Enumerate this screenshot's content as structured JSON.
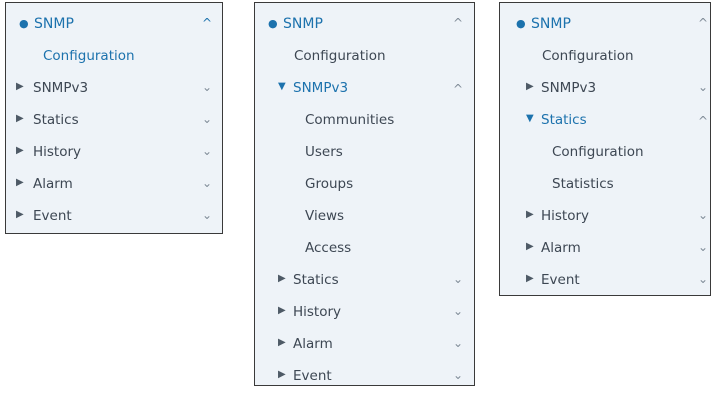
{
  "icons": {
    "bullet": "●",
    "collapsed": "▶",
    "expanded": "▼",
    "chevron_up": "^",
    "chevron_down": "⌄"
  },
  "colors": {
    "accent": "#1c72ad",
    "panel_bg": "#eef3f8",
    "text": "#3d4753"
  },
  "panel1": {
    "root": "SNMP",
    "configuration": "Configuration",
    "items": [
      "SNMPv3",
      "Statics",
      "History",
      "Alarm",
      "Event"
    ]
  },
  "panel2": {
    "root": "SNMP",
    "configuration": "Configuration",
    "open_item": "SNMPv3",
    "sub_items": [
      "Communities",
      "Users",
      "Groups",
      "Views",
      "Access"
    ],
    "items": [
      "Statics",
      "History",
      "Alarm",
      "Event"
    ]
  },
  "panel3": {
    "root": "SNMP",
    "configuration": "Configuration",
    "items_before": [
      "SNMPv3"
    ],
    "open_item": "Statics",
    "sub_items": [
      "Configuration",
      "Statistics"
    ],
    "items_after": [
      "History",
      "Alarm",
      "Event"
    ]
  }
}
